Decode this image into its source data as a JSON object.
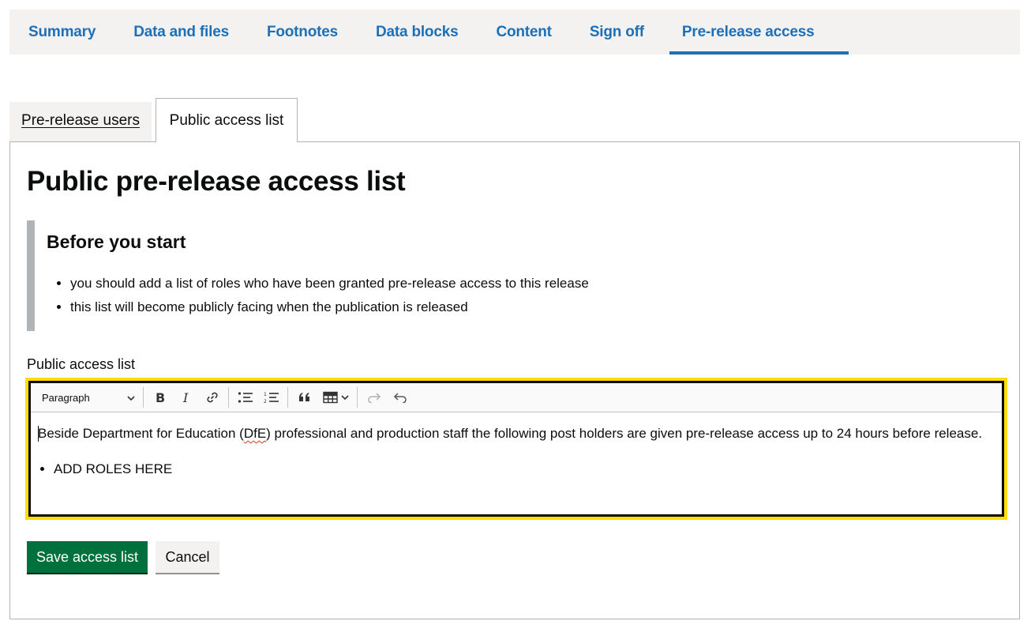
{
  "nav": {
    "items": [
      {
        "label": "Summary"
      },
      {
        "label": "Data and files"
      },
      {
        "label": "Footnotes"
      },
      {
        "label": "Data blocks"
      },
      {
        "label": "Content"
      },
      {
        "label": "Sign off"
      },
      {
        "label": "Pre-release access",
        "active": true
      }
    ]
  },
  "tabs": {
    "users_label": "Pre-release users",
    "public_label": "Public access list"
  },
  "panel": {
    "title": "Public pre-release access list",
    "inset": {
      "heading": "Before you start",
      "items": [
        "you should add a list of roles who have been granted pre-release access to this release",
        "this list will become publicly facing when the publication is released"
      ]
    },
    "field_label": "Public access list",
    "editor": {
      "block_format": "Paragraph",
      "toolbar_icons": [
        "bold-icon",
        "italic-icon",
        "link-icon",
        "bulleted-list-icon",
        "numbered-list-icon",
        "block-quote-icon",
        "table-icon",
        "redo-icon",
        "undo-icon"
      ],
      "text_before": "Beside Department for Education (",
      "text_dfe": "DfE",
      "text_after": ") professional and production staff the following post holders are given pre-release access up to 24 hours before release.",
      "list_items": [
        "ADD ROLES HERE"
      ]
    },
    "buttons": {
      "save": "Save access list",
      "cancel": "Cancel"
    }
  },
  "colors": {
    "link_blue": "#1d70b8",
    "save_green": "#00703c",
    "focus_yellow": "#ffdd00",
    "nav_bg": "#f3f2f1"
  }
}
